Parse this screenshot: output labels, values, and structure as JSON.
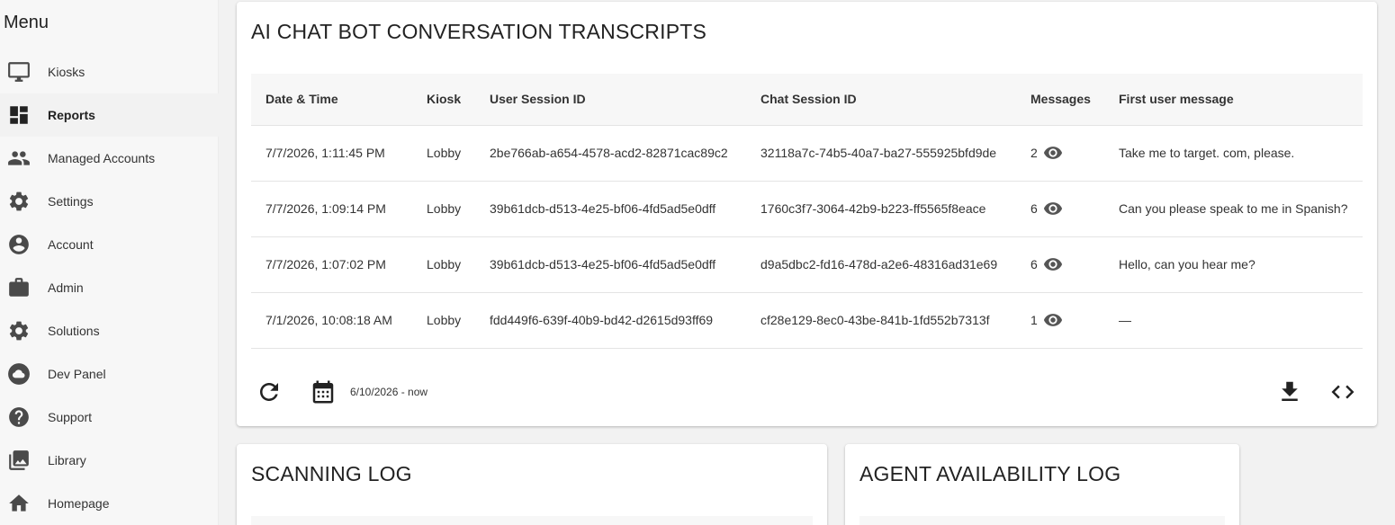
{
  "sidebar": {
    "title": "Menu",
    "items": [
      {
        "label": "Kiosks",
        "icon": "monitor-icon"
      },
      {
        "label": "Reports",
        "icon": "dashboard-icon",
        "active": true
      },
      {
        "label": "Managed Accounts",
        "icon": "people-icon"
      },
      {
        "label": "Settings",
        "icon": "gear-icon"
      },
      {
        "label": "Account",
        "icon": "account-circle-icon"
      },
      {
        "label": "Admin",
        "icon": "briefcase-icon"
      },
      {
        "label": "Solutions",
        "icon": "gear-icon"
      },
      {
        "label": "Dev Panel",
        "icon": "cloud-icon"
      },
      {
        "label": "Support",
        "icon": "help-icon"
      },
      {
        "label": "Library",
        "icon": "photo-library-icon"
      },
      {
        "label": "Homepage",
        "icon": "home-icon"
      }
    ]
  },
  "transcripts": {
    "title": "AI CHAT BOT CONVERSATION TRANSCRIPTS",
    "columns": [
      "Date & Time",
      "Kiosk",
      "User Session ID",
      "Chat Session ID",
      "Messages",
      "First user message"
    ],
    "rows": [
      {
        "datetime": "7/7/2026, 1:11:45 PM",
        "kiosk": "Lobby",
        "user_session": "2be766ab-a654-4578-acd2-82871cac89c2",
        "chat_session": "32118a7c-74b5-40a7-ba27-555925bfd9de",
        "messages": "2",
        "first_message": "Take me to target. com, please."
      },
      {
        "datetime": "7/7/2026, 1:09:14 PM",
        "kiosk": "Lobby",
        "user_session": "39b61dcb-d513-4e25-bf06-4fd5ad5e0dff",
        "chat_session": "1760c3f7-3064-42b9-b223-ff5565f8eace",
        "messages": "6",
        "first_message": "Can you please speak to me in Spanish?"
      },
      {
        "datetime": "7/7/2026, 1:07:02 PM",
        "kiosk": "Lobby",
        "user_session": "39b61dcb-d513-4e25-bf06-4fd5ad5e0dff",
        "chat_session": "d9a5dbc2-fd16-478d-a2e6-48316ad31e69",
        "messages": "6",
        "first_message": "Hello, can you hear me?"
      },
      {
        "datetime": "7/1/2026, 10:08:18 AM",
        "kiosk": "Lobby",
        "user_session": "fdd449f6-639f-40b9-bd42-d2615d93ff69",
        "chat_session": "cf28e129-8ec0-43be-841b-1fd552b7313f",
        "messages": "1",
        "first_message": "—"
      }
    ],
    "date_range": "6/10/2026 - now"
  },
  "scanning_log": {
    "title": "SCANNING LOG"
  },
  "agent_log": {
    "title": "AGENT AVAILABILITY LOG"
  }
}
